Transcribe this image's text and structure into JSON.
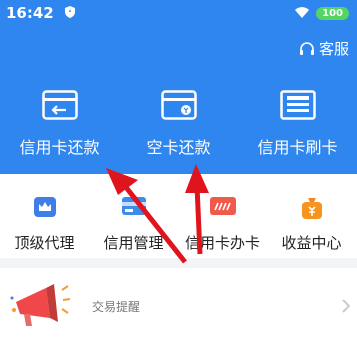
{
  "status_bar": {
    "time": "16:42",
    "battery": "100"
  },
  "header": {
    "customer_service_label": "客服"
  },
  "features": [
    {
      "label": "信用卡还款",
      "icon": "credit-card-return-icon"
    },
    {
      "label": "空卡还款",
      "icon": "card-payment-icon"
    },
    {
      "label": "信用卡刷卡",
      "icon": "pos-terminal-icon"
    }
  ],
  "grid": [
    {
      "label": "顶级代理",
      "icon": "crown-icon"
    },
    {
      "label": "信用管理",
      "icon": "card-stack-icon"
    },
    {
      "label": "信用卡办卡",
      "icon": "card-apply-icon"
    },
    {
      "label": "收益中心",
      "icon": "money-bag-icon"
    }
  ],
  "notice": {
    "label": "交易提醒",
    "icon": "megaphone-icon"
  },
  "colors": {
    "header_blue": "#2f86ee",
    "annotation_red": "#e0141c"
  }
}
